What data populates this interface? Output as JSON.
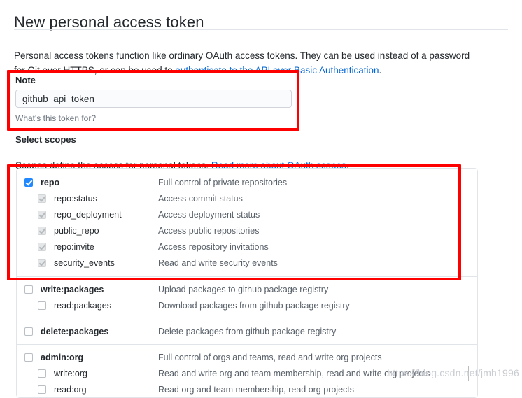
{
  "page": {
    "title": "New personal access token",
    "intro_before_link": "Personal access tokens function like ordinary OAuth access tokens. They can be used instead of a password for Git over HTTPS, or can be used to ",
    "intro_link": "authenticate to the API over Basic Authentication",
    "intro_after_link": "."
  },
  "note": {
    "label": "Note",
    "value": "github_api_token",
    "placeholder": "What's this token for?",
    "hint": "What's this token for?"
  },
  "scopes": {
    "title": "Select scopes",
    "sub_before_link": "Scopes define the access for personal tokens. ",
    "sub_link": "Read more about OAuth scopes",
    "sub_after_link": ".",
    "groups": [
      {
        "id": "repo",
        "rows": [
          {
            "name": "repo",
            "desc": "Full control of private repositories",
            "level": "parent",
            "state": "checked"
          },
          {
            "name": "repo:status",
            "desc": "Access commit status",
            "level": "child",
            "state": "disabled-checked"
          },
          {
            "name": "repo_deployment",
            "desc": "Access deployment status",
            "level": "child",
            "state": "disabled-checked"
          },
          {
            "name": "public_repo",
            "desc": "Access public repositories",
            "level": "child",
            "state": "disabled-checked"
          },
          {
            "name": "repo:invite",
            "desc": "Access repository invitations",
            "level": "child",
            "state": "disabled-checked"
          },
          {
            "name": "security_events",
            "desc": "Read and write security events",
            "level": "child",
            "state": "disabled-checked"
          }
        ]
      },
      {
        "id": "packages",
        "rows": [
          {
            "name": "write:packages",
            "desc": "Upload packages to github package registry",
            "level": "parent",
            "state": "unchecked"
          },
          {
            "name": "read:packages",
            "desc": "Download packages from github package registry",
            "level": "child",
            "state": "unchecked"
          }
        ]
      },
      {
        "id": "delete-packages",
        "rows": [
          {
            "name": "delete:packages",
            "desc": "Delete packages from github package registry",
            "level": "parent",
            "state": "unchecked"
          }
        ]
      },
      {
        "id": "admin-org",
        "rows": [
          {
            "name": "admin:org",
            "desc": "Full control of orgs and teams, read and write org projects",
            "level": "parent",
            "state": "unchecked"
          },
          {
            "name": "write:org",
            "desc": "Read and write org and team membership, read and write org projects",
            "level": "child",
            "state": "unchecked"
          },
          {
            "name": "read:org",
            "desc": "Read org and team membership, read org projects",
            "level": "child",
            "state": "unchecked"
          }
        ]
      }
    ]
  },
  "annotations": [
    {
      "id": "note-highlight",
      "color": "#ff0000"
    },
    {
      "id": "repo-scope-highlight",
      "color": "#ff0000"
    }
  ],
  "watermark": {
    "text": "https://blog.csdn.net/jmh1996"
  }
}
